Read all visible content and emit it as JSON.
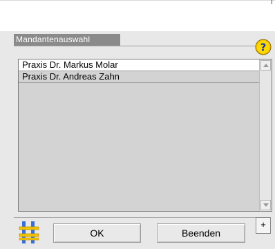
{
  "dialog": {
    "group_title": "Mandantenauswahl",
    "help_icon": "question-mark-icon",
    "app_icon": "hash-symbol-icon"
  },
  "list": {
    "items": [
      {
        "label": "Praxis Dr. Markus Molar",
        "selected": true
      },
      {
        "label": "Praxis Dr. Andreas Zahn",
        "selected": false
      }
    ]
  },
  "buttons": {
    "ok_label": "OK",
    "quit_label": "Beenden",
    "plus_label": "+"
  },
  "colors": {
    "title_bg": "#8a8a8a",
    "list_bg": "#d3d3d3",
    "help_icon": "#f2c300",
    "app_icon_blue": "#3a6fd8",
    "app_icon_yellow": "#f2c300"
  }
}
